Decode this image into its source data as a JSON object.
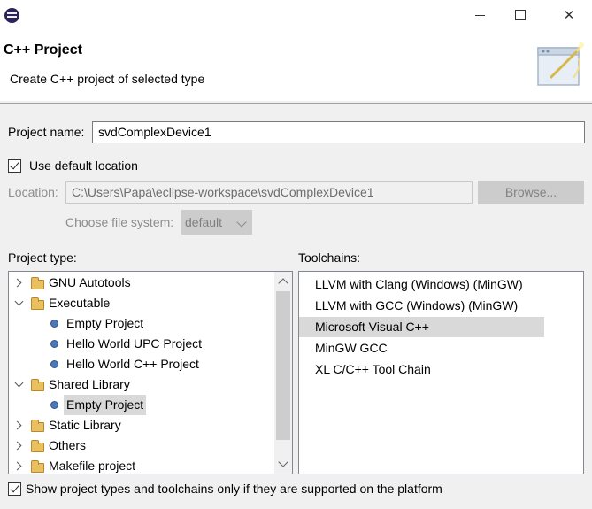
{
  "window": {
    "close_glyph": "✕"
  },
  "header": {
    "title": "C++ Project",
    "description": "Create C++ project of selected type"
  },
  "form": {
    "project_name_label": "Project name:",
    "project_name_value": "svdComplexDevice1",
    "use_default_location_label": "Use default location",
    "use_default_location_checked": true,
    "location_label": "Location:",
    "location_value": "C:\\Users\\Papa\\eclipse-workspace\\svdComplexDevice1",
    "browse_label": "Browse...",
    "file_system_label": "Choose file system:",
    "file_system_value": "default"
  },
  "project_types": {
    "label": "Project type:",
    "items": [
      {
        "label": "GNU Autotools",
        "icon": "folder-icon",
        "state": "collapsed"
      },
      {
        "label": "Executable",
        "icon": "folder-icon",
        "state": "expanded"
      },
      {
        "label": "Empty Project",
        "icon": "bullet-icon"
      },
      {
        "label": "Hello World UPC Project",
        "icon": "bullet-icon"
      },
      {
        "label": "Hello World C++ Project",
        "icon": "bullet-icon"
      },
      {
        "label": "Shared Library",
        "icon": "folder-icon",
        "state": "expanded"
      },
      {
        "label": "Empty Project",
        "icon": "bullet-icon",
        "selected": true
      },
      {
        "label": "Static Library",
        "icon": "folder-icon",
        "state": "collapsed"
      },
      {
        "label": "Others",
        "icon": "folder-icon",
        "state": "collapsed"
      },
      {
        "label": "Makefile project",
        "icon": "folder-icon",
        "state": "collapsed"
      }
    ]
  },
  "toolchains": {
    "label": "Toolchains:",
    "items": [
      {
        "label": "LLVM with Clang (Windows) (MinGW)"
      },
      {
        "label": "LLVM with GCC (Windows) (MinGW)"
      },
      {
        "label": "Microsoft Visual C++",
        "selected": true
      },
      {
        "label": "MinGW GCC"
      },
      {
        "label": "XL C/C++ Tool Chain"
      }
    ]
  },
  "footer": {
    "show_supported_label": "Show project types and toolchains only if they are supported on the platform",
    "show_supported_checked": true
  },
  "colors": {
    "selection": "#d9d9d9",
    "folder": "#e9bf5f",
    "bullet": "#4a78b8"
  }
}
